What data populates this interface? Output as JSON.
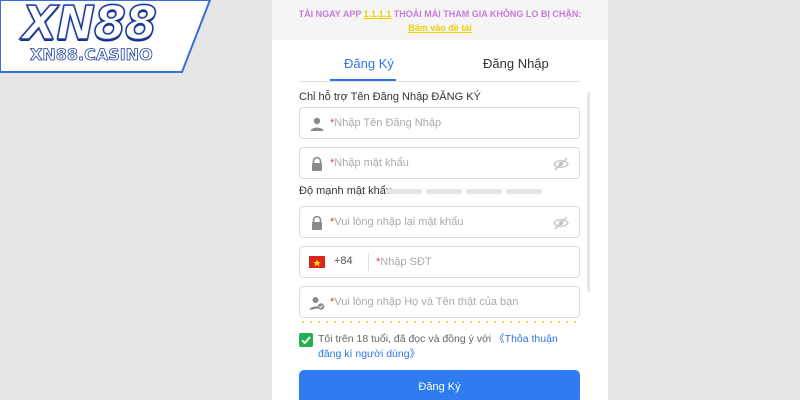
{
  "brand": {
    "logo_text": "XN88",
    "logo_sub": "XN88.CASINO"
  },
  "promo": {
    "text_before": "TẢI NGAY APP ",
    "highlight": "1.1.1.1",
    "text_after": " THOẢI MÁI THAM GIA KHÔNG LO BỊ CHẶN:",
    "link": "Bấm vào đề tải"
  },
  "tabs": {
    "register": "Đăng Ký",
    "login": "Đăng Nhập"
  },
  "form": {
    "hint": "Chỉ hỗ trợ Tên Đăng Nhập ĐĂNG KÝ",
    "required_mark": "*",
    "username_placeholder": "Nhập Tên Đăng Nhập",
    "password_placeholder": "Nhập mật khẩu",
    "strength_label": "Độ mạnh mật khẩu",
    "confirm_placeholder": "Vui lòng nhập lại mật khẩu",
    "country_code": "+84",
    "phone_placeholder": "Nhập SĐT",
    "fullname_placeholder": "Vui lòng nhập Họ và Tên thật của bạn",
    "agree_text": "Tôi trên 18 tuổi, đã đọc và đồng ý với ",
    "agree_link": "《Thỏa thuận đăng kí người dùng》",
    "agree_checked": true,
    "submit_label": "Đăng Ký"
  },
  "icons": {
    "user": "user-icon",
    "lock": "lock-icon",
    "eye_off": "eye-off-icon",
    "flag": "vietnam-flag-icon",
    "user_check": "user-check-icon",
    "checkbox": "checkbox-checked-icon"
  },
  "colors": {
    "accent": "#2f7bf0",
    "check": "#22b14c",
    "promo": "#c77bd6",
    "promo_highlight": "#f0d000"
  }
}
